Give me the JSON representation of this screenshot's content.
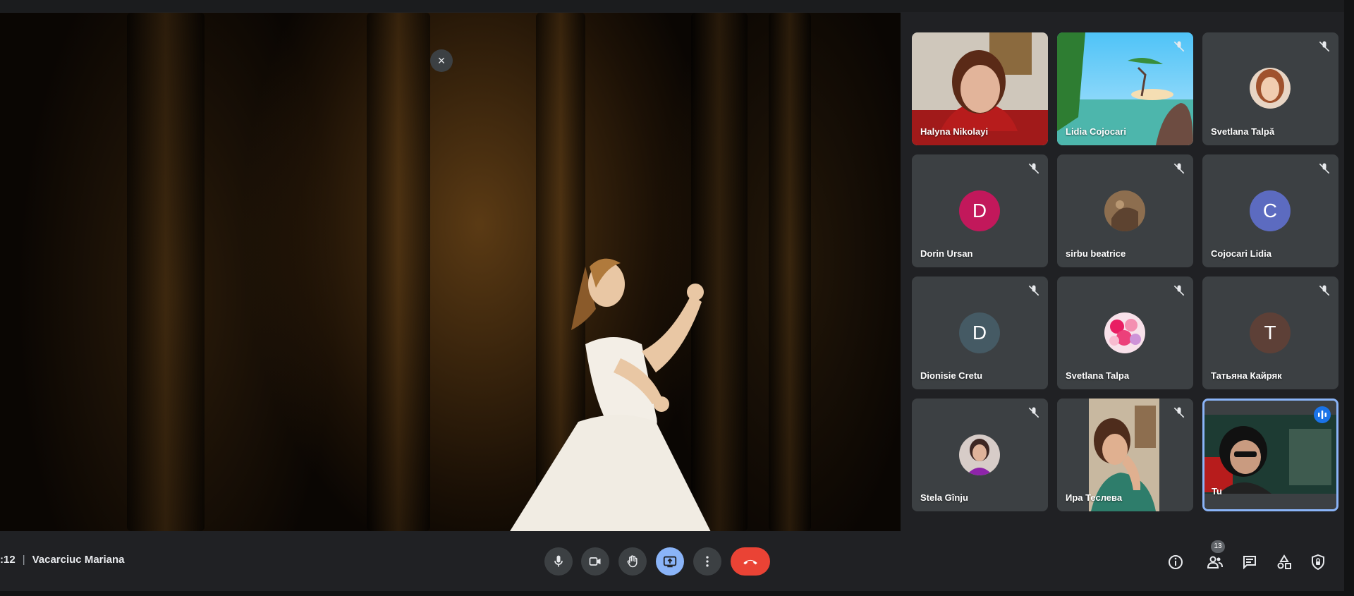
{
  "meeting": {
    "time_fragment": ":12",
    "title": "Vacarciuc Mariana"
  },
  "stage": {
    "close_glyph": "×"
  },
  "participants": [
    {
      "name": "Halyna Nikolayi",
      "kind": "video",
      "muted": false
    },
    {
      "name": "Lidia Cojocari",
      "kind": "video",
      "muted": true
    },
    {
      "name": "Svetlana Talpă",
      "kind": "photo",
      "muted": true
    },
    {
      "name": "Dorin Ursan",
      "kind": "initial",
      "initial": "D",
      "color": "#c2185b",
      "muted": true
    },
    {
      "name": "sirbu beatrice",
      "kind": "photo",
      "muted": true
    },
    {
      "name": "Cojocari Lidia",
      "kind": "initial",
      "initial": "C",
      "color": "#5c6bc0",
      "muted": true
    },
    {
      "name": "Dionisie Cretu",
      "kind": "initial",
      "initial": "D",
      "color": "#455a64",
      "muted": true
    },
    {
      "name": "Svetlana Talpa",
      "kind": "photo",
      "muted": true
    },
    {
      "name": "Татьяна Кайряк",
      "kind": "initial",
      "initial": "T",
      "color": "#5d4037",
      "muted": true
    },
    {
      "name": "Stela Gînju",
      "kind": "photo",
      "muted": true
    },
    {
      "name": "Ира Теслева",
      "kind": "video",
      "muted": true
    },
    {
      "name": "Tu",
      "kind": "video",
      "self": true,
      "speaking": true
    }
  ],
  "controls": {
    "participant_count": "13",
    "icons": [
      "mic-icon",
      "camera-icon",
      "raise-hand-icon",
      "present-screen-icon",
      "more-options-icon",
      "end-call-icon"
    ],
    "right_icons": [
      "info-icon",
      "people-icon",
      "chat-icon",
      "activities-icon",
      "host-controls-icon"
    ]
  },
  "colors": {
    "background": "#202124",
    "tile": "#3c4043",
    "present_active": "#8ab4f8",
    "end_call": "#ea4335",
    "self_border": "#8ab4f8"
  }
}
